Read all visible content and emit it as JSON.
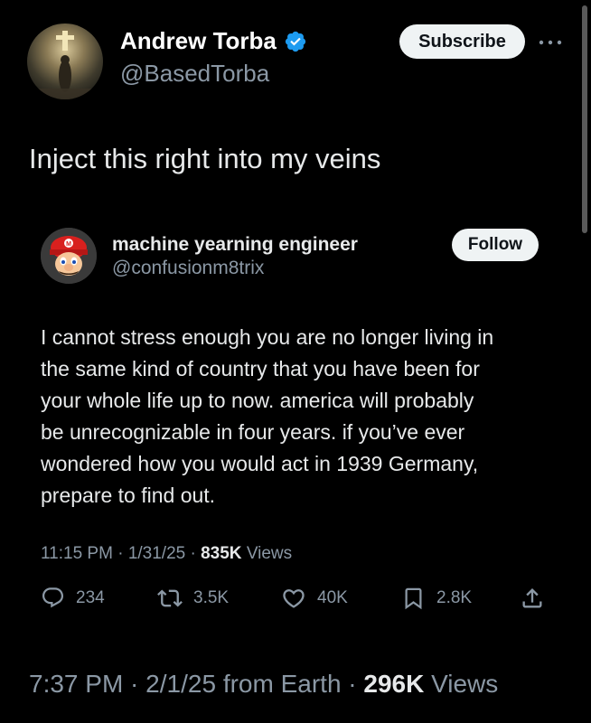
{
  "author": {
    "name": "Andrew Torba",
    "handle": "@BasedTorba",
    "verified": true,
    "avatar_icon": "cross-painting-avatar-icon"
  },
  "subscribe_label": "Subscribe",
  "post_text": "Inject this right into my veins",
  "quoted": {
    "name": "machine yearning engineer",
    "handle": "@confusionm8trix",
    "avatar_icon": "mario-avatar-icon",
    "follow_label": "Follow",
    "lines": [
      "I cannot stress enough you are no longer living in",
      "the same kind of country that you have been for",
      "your whole life up to now. america will probably",
      "be unrecognizable in four years. if you’ve ever",
      "wondered how you would act in 1939 Germany,",
      "prepare to find out."
    ],
    "time": "11:15 PM",
    "date": "1/31/25",
    "views_count": "835K",
    "views_label": "Views",
    "actions": {
      "replies": "234",
      "reposts": "3.5K",
      "likes": "40K",
      "bookmarks": "2.8K"
    }
  },
  "meta": {
    "time": "7:37 PM",
    "date": "2/1/25",
    "source": "from Earth",
    "views_count": "296K",
    "views_label": "Views"
  },
  "colors": {
    "background": "#000000",
    "text": "#e7e9ea",
    "muted": "#8b98a5",
    "verified": "#1d9bf0",
    "button": "#eff3f4"
  }
}
